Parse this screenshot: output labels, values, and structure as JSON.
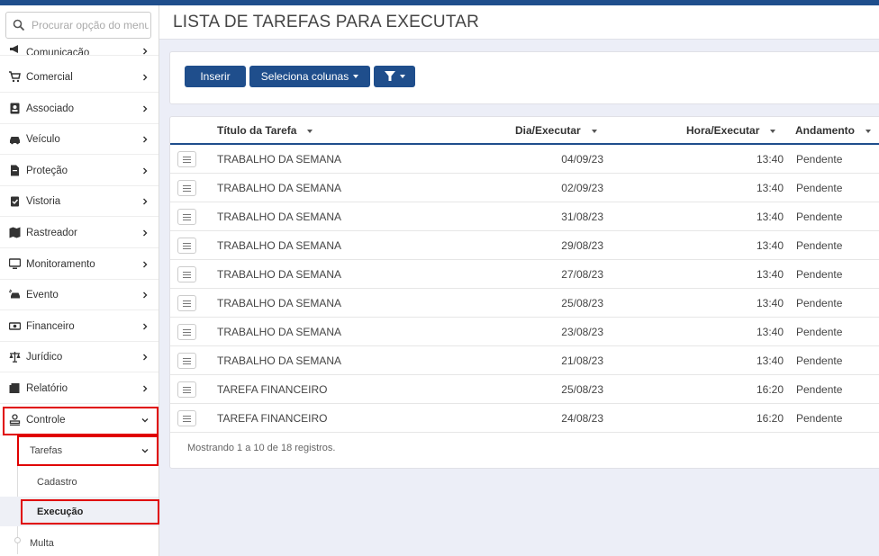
{
  "sidebar": {
    "search_placeholder": "Procurar opção do menu",
    "items": [
      {
        "label": "Comunicação",
        "icon": "megaphone-icon"
      },
      {
        "label": "Comercial",
        "icon": "cart-icon"
      },
      {
        "label": "Associado",
        "icon": "id-card-icon"
      },
      {
        "label": "Veículo",
        "icon": "car-icon"
      },
      {
        "label": "Proteção",
        "icon": "document-icon"
      },
      {
        "label": "Vistoria",
        "icon": "clipboard-check-icon"
      },
      {
        "label": "Rastreador",
        "icon": "map-icon"
      },
      {
        "label": "Monitoramento",
        "icon": "monitor-icon"
      },
      {
        "label": "Evento",
        "icon": "car-crash-icon"
      },
      {
        "label": "Financeiro",
        "icon": "money-icon"
      },
      {
        "label": "Jurídico",
        "icon": "scale-icon"
      },
      {
        "label": "Relatório",
        "icon": "report-icon"
      },
      {
        "label": "Controle",
        "icon": "user-stamp-icon"
      }
    ],
    "submenu": {
      "tarefas": "Tarefas",
      "cadastro": "Cadastro",
      "execucao": "Execução",
      "multa": "Multa"
    }
  },
  "header": {
    "title": "LISTA DE TAREFAS PARA EXECUTAR"
  },
  "toolbar": {
    "insert_label": "Inserir",
    "columns_label": "Seleciona colunas",
    "filter_icon": "filter-icon"
  },
  "table": {
    "columns": [
      "Título da Tarefa",
      "Dia/Executar",
      "Hora/Executar",
      "Andamento"
    ],
    "rows": [
      {
        "title": "TRABALHO DA SEMANA",
        "date": "04/09/23",
        "hour": "13:40",
        "status": "Pendente"
      },
      {
        "title": "TRABALHO DA SEMANA",
        "date": "02/09/23",
        "hour": "13:40",
        "status": "Pendente"
      },
      {
        "title": "TRABALHO DA SEMANA",
        "date": "31/08/23",
        "hour": "13:40",
        "status": "Pendente"
      },
      {
        "title": "TRABALHO DA SEMANA",
        "date": "29/08/23",
        "hour": "13:40",
        "status": "Pendente"
      },
      {
        "title": "TRABALHO DA SEMANA",
        "date": "27/08/23",
        "hour": "13:40",
        "status": "Pendente"
      },
      {
        "title": "TRABALHO DA SEMANA",
        "date": "25/08/23",
        "hour": "13:40",
        "status": "Pendente"
      },
      {
        "title": "TRABALHO DA SEMANA",
        "date": "23/08/23",
        "hour": "13:40",
        "status": "Pendente"
      },
      {
        "title": "TRABALHO DA SEMANA",
        "date": "21/08/23",
        "hour": "13:40",
        "status": "Pendente"
      },
      {
        "title": "TAREFA FINANCEIRO",
        "date": "25/08/23",
        "hour": "16:20",
        "status": "Pendente"
      },
      {
        "title": "TAREFA FINANCEIRO",
        "date": "24/08/23",
        "hour": "16:20",
        "status": "Pendente"
      }
    ],
    "footer": "Mostrando 1 a 10 de 18 registros."
  },
  "colors": {
    "primary": "#1f4e8c",
    "highlight": "#e00000",
    "background": "#eceef7"
  }
}
